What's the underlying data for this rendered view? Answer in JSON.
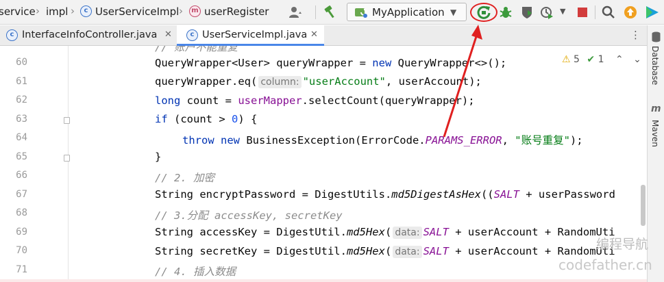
{
  "breadcrumbs": [
    {
      "label": "service"
    },
    {
      "label": "impl"
    },
    {
      "label": "UserServiceImpl",
      "kind_icon": "class-icon"
    },
    {
      "label": "userRegister",
      "kind_icon": "method-icon"
    }
  ],
  "breadcrumb_badges": {
    "class": "c",
    "method": "m"
  },
  "toolbar": {
    "run_configuration": "MyApplication",
    "icons": [
      "user-icon",
      "hammer-build-icon",
      "rerun-icon",
      "debug-icon",
      "coverage-icon",
      "profile-icon",
      "stop-icon",
      "search-icon",
      "update-icon",
      "plugin-icon"
    ]
  },
  "tabs": [
    {
      "label": "InterfaceInfoController.java",
      "active": false
    },
    {
      "label": "UserServiceImpl.java",
      "active": true
    }
  ],
  "tab_badge": "c",
  "inspections": {
    "warnings": "5",
    "checks": "1"
  },
  "right_panels": [
    {
      "label": "Database"
    },
    {
      "label": "Maven"
    }
  ],
  "right_panel_badge": "m",
  "code": {
    "lines": [
      {
        "num": "60"
      },
      {
        "num": "61"
      },
      {
        "num": "62"
      },
      {
        "num": "63"
      },
      {
        "num": "64"
      },
      {
        "num": "65"
      },
      {
        "num": "66"
      },
      {
        "num": "67"
      },
      {
        "num": "68"
      },
      {
        "num": "69"
      },
      {
        "num": "70"
      },
      {
        "num": "71"
      }
    ],
    "t": {
      "c0": "// 账户不能重复",
      "l60_a": "QueryWrapper<User> queryWrapper = ",
      "l60_kw": "new",
      "l60_b": " QueryWrapper<>();",
      "l61_a": "queryWrapper.eq(",
      "l61_hint": "column:",
      "l61_str": "\"userAccount\"",
      "l61_b": ", userAccount);",
      "l62_kw": "long",
      "l62_a": " count = ",
      "l62_mem": "userMapper",
      "l62_b": ".selectCount(queryWrapper);",
      "l63_kw": "if",
      "l63_a": " (count > ",
      "l63_num": "0",
      "l63_b": ") {",
      "l64_kw1": "throw",
      "l64_sp": " ",
      "l64_kw2": "new",
      "l64_a": " BusinessException(ErrorCode.",
      "l64_fld": "PARAMS_ERROR",
      "l64_b": ", ",
      "l64_str": "\"账号重复\"",
      "l64_c": ");",
      "l65_a": "}",
      "l66_cm": "// 2. 加密",
      "l67_a": "String encryptPassword = DigestUtils.",
      "l67_it": "md5DigestAsHex",
      "l67_b": "((",
      "l67_fld": "SALT",
      "l67_c": " + userPassword",
      "l68_cm": "// 3.分配 accessKey, secretKey",
      "l69_a": "String accessKey = DigestUtil.",
      "l69_it": "md5Hex",
      "l69_b": "(",
      "l69_hint": "data:",
      "l69_fld": "SALT",
      "l69_c": " + userAccount + RandomUti",
      "l70_a": "String secretKey = DigestUtil.",
      "l70_it": "md5Hex",
      "l70_b": "(",
      "l70_hint": "data:",
      "l70_fld": "SALT",
      "l70_c": " + userAccount + RandomUti",
      "l71_cm": "// 4. 插入数据"
    }
  },
  "watermark": {
    "line1": "编程导航",
    "line2": "codefather.cn"
  },
  "colors": {
    "annotation": "#e02020",
    "accent": "#4a86e8"
  }
}
